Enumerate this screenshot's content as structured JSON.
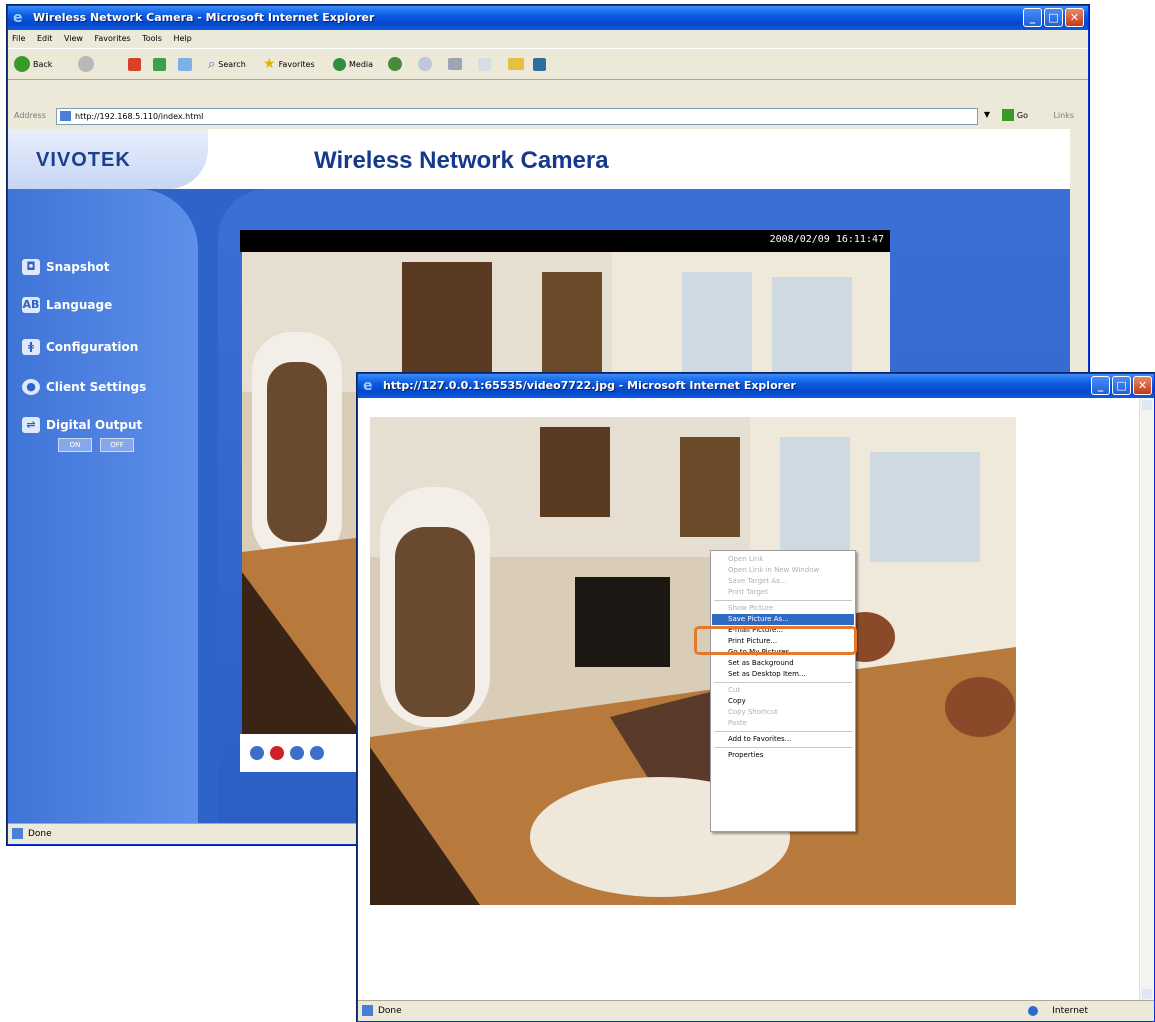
{
  "main_window": {
    "title": "Wireless Network Camera - Microsoft Internet Explorer",
    "menu": [
      "File",
      "Edit",
      "View",
      "Favorites",
      "Tools",
      "Help"
    ],
    "toolbar": {
      "back": "Back",
      "search": "Search",
      "favorites": "Favorites",
      "media": "Media"
    },
    "address_label": "Address",
    "address_url": "http://192.168.5.110/index.html",
    "go_label": "Go",
    "links_label": "Links",
    "status": "Done"
  },
  "camera_page": {
    "brand": "VIVOTEK",
    "title": "Wireless Network Camera",
    "timestamp": "2008/02/09 16:11:47",
    "nav": [
      {
        "label": "Snapshot",
        "icon": "camera-icon"
      },
      {
        "label": "Language",
        "icon": "language-icon"
      },
      {
        "label": "Configuration",
        "icon": "configuration-icon"
      },
      {
        "label": "Client Settings",
        "icon": "client-settings-icon"
      },
      {
        "label": "Digital Output",
        "icon": "digital-output-icon"
      }
    ],
    "output_on": "ON",
    "output_off": "OFF"
  },
  "snapshot_window": {
    "title": "http://127.0.0.1:65535/video7722.jpg - Microsoft Internet Explorer",
    "status": "Done",
    "zone": "Internet",
    "context_menu": [
      {
        "label": "Open Link",
        "disabled": true
      },
      {
        "label": "Open Link in New Window",
        "disabled": true
      },
      {
        "label": "Save Target As...",
        "disabled": true
      },
      {
        "label": "Print Target",
        "disabled": true
      },
      {
        "separator": true
      },
      {
        "label": "Show Picture",
        "disabled": true
      },
      {
        "label": "Save Picture As...",
        "selected": true
      },
      {
        "label": "E-mail Picture..."
      },
      {
        "label": "Print Picture..."
      },
      {
        "label": "Go to My Pictures"
      },
      {
        "label": "Set as Background"
      },
      {
        "label": "Set as Desktop Item..."
      },
      {
        "separator": true
      },
      {
        "label": "Cut",
        "disabled": true
      },
      {
        "label": "Copy"
      },
      {
        "label": "Copy Shortcut",
        "disabled": true
      },
      {
        "label": "Paste",
        "disabled": true
      },
      {
        "separator": true
      },
      {
        "label": "Add to Favorites..."
      },
      {
        "separator": true
      },
      {
        "label": "Properties"
      }
    ]
  },
  "colors": {
    "xp_title_blue": "#0b5ae3",
    "page_blue": "#2e63c9",
    "highlight_orange": "#e4782b",
    "menu_selection": "#316ac5"
  }
}
